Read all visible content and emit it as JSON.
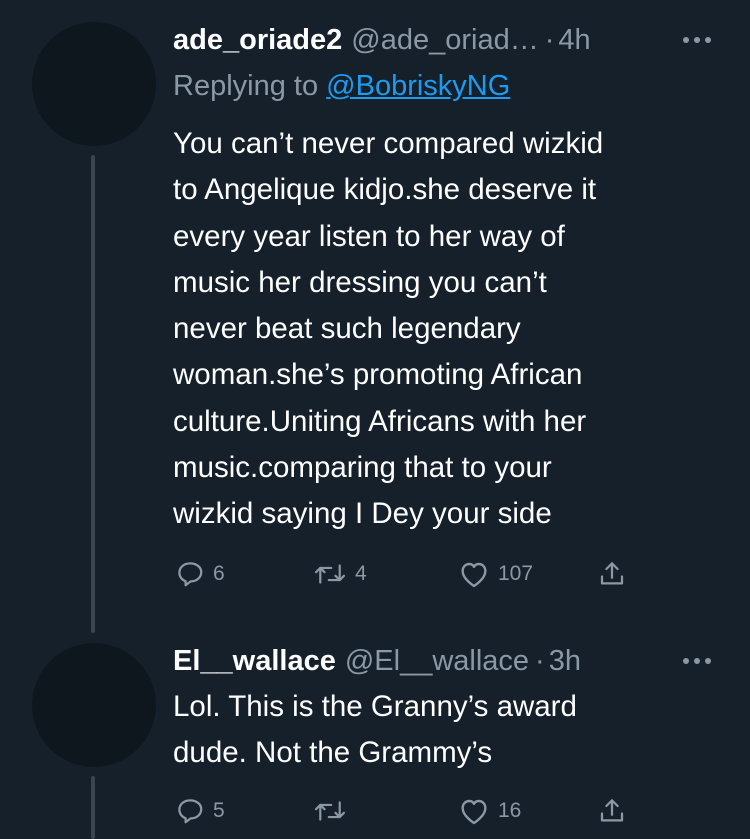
{
  "tweets": [
    {
      "display_name": "ade_oriade2",
      "handle": "@ade_oriad…",
      "separator": "·",
      "time": "4h",
      "reply_prefix": "Replying to",
      "reply_mention": "@BobriskyNG",
      "text": "You can’t never compared wizkid\nto Angelique kidjo.she deserve it\nevery year listen to her way of\nmusic her dressing you can’t\nnever beat such legendary\nwoman.she’s promoting African\nculture.Uniting Africans with her\nmusic.comparing that to your\nwizkid saying I Dey your side",
      "replies": "6",
      "retweets": "4",
      "likes": "107"
    },
    {
      "display_name": "El__wallace",
      "handle": "@El__wallace",
      "separator": "·",
      "time": "3h",
      "text": "Lol. This is the Granny’s award\ndude. Not the Grammy’s",
      "replies": "5",
      "retweets": "",
      "likes": "16"
    }
  ],
  "icons": {
    "reply": "speech-bubble-icon",
    "retweet": "retweet-arrows-icon",
    "like": "heart-outline-icon",
    "share": "share-upload-icon",
    "more": "more-dots-icon"
  },
  "colors": {
    "background": "#15202b",
    "text": "#ffffff",
    "muted": "#8b98a5",
    "link": "#1d9bf0",
    "avatar": "#0f171e",
    "thread_line": "#3a4550"
  }
}
